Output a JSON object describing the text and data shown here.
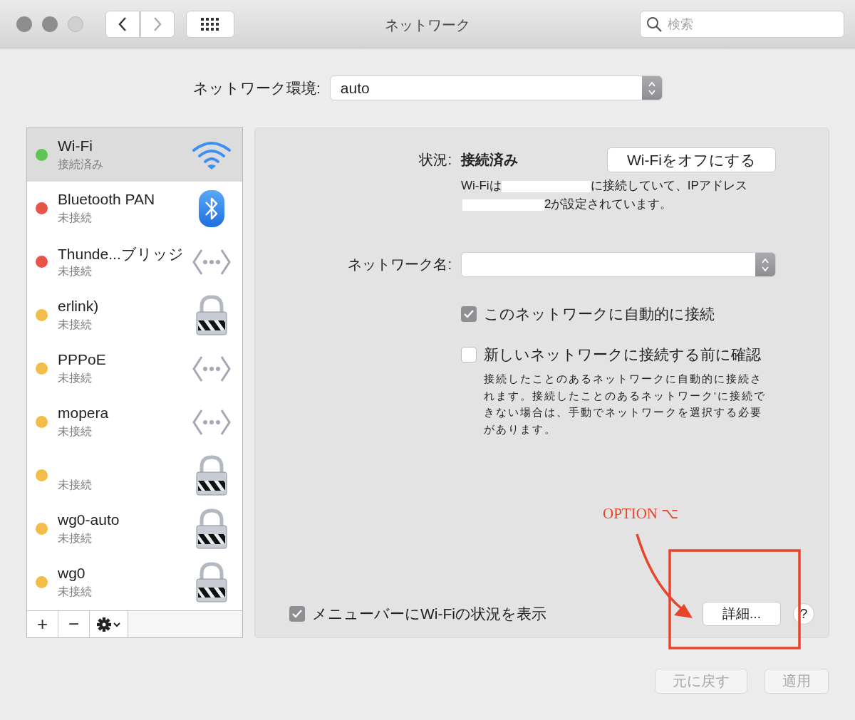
{
  "window": {
    "title": "ネットワーク",
    "search": {
      "placeholder": "検索"
    }
  },
  "location": {
    "label": "ネットワーク環境:",
    "value": "auto"
  },
  "services": [
    {
      "name": "Wi-Fi",
      "status": "接続済み",
      "color": "#5ec452",
      "kind": "wifi",
      "selected": true
    },
    {
      "name": "Bluetooth PAN",
      "status": "未接続",
      "color": "#e9534a",
      "kind": "bluetooth",
      "selected": false
    },
    {
      "name": "Thunde...ブリッジ",
      "status": "未接続",
      "color": "#e9534a",
      "kind": "dots",
      "selected": false
    },
    {
      "name": "erlink)",
      "status": "未接続",
      "color": "#f4bc48",
      "kind": "lock",
      "selected": false
    },
    {
      "name": "PPPoE",
      "status": "未接続",
      "color": "#f4bc48",
      "kind": "dots",
      "selected": false
    },
    {
      "name": "mopera",
      "status": "未接続",
      "color": "#f4bc48",
      "kind": "dots",
      "selected": false
    },
    {
      "status": "未接続",
      "color": "#f4bc48",
      "kind": "lock",
      "selected": false
    },
    {
      "name": "wg0-auto",
      "status": "未接続",
      "color": "#f4bc48",
      "kind": "lock",
      "selected": false
    },
    {
      "name": "wg0",
      "status": "未接続",
      "color": "#f4bc48",
      "kind": "lock",
      "selected": false
    }
  ],
  "service_toolbar": {
    "add": "+",
    "remove": "−"
  },
  "detail": {
    "status_label": "状況:",
    "status_value": "接続済み",
    "toggle_button": "Wi-Fiをオフにする",
    "description": {
      "before": "Wi-Fiは",
      "after": "に接続していて、IPアドレス",
      "line_2": "2が設定されています。"
    },
    "network_name_label": "ネットワーク名:",
    "checkboxes": [
      {
        "label": "このネットワークに自動的に接続",
        "checked": true
      },
      {
        "label": "新しいネットワークに接続する前に確認",
        "checked": false
      }
    ],
    "help_text": "接続したことのあるネットワークに自動的に接続されます。接続したことのあるネットワーク'に接続できない場合は、手動でネットワークを選択する必要があります。",
    "menubar_checkbox": {
      "label": "メニューバーにWi-Fiの状況を表示",
      "checked": true
    },
    "advanced_button": "詳細...",
    "help_button": "?"
  },
  "footer": [
    {
      "label": "元に戻す",
      "disabled": true
    },
    {
      "label": "適用",
      "disabled": true
    }
  ],
  "annotation": {
    "text": "OPTION ⌥"
  }
}
